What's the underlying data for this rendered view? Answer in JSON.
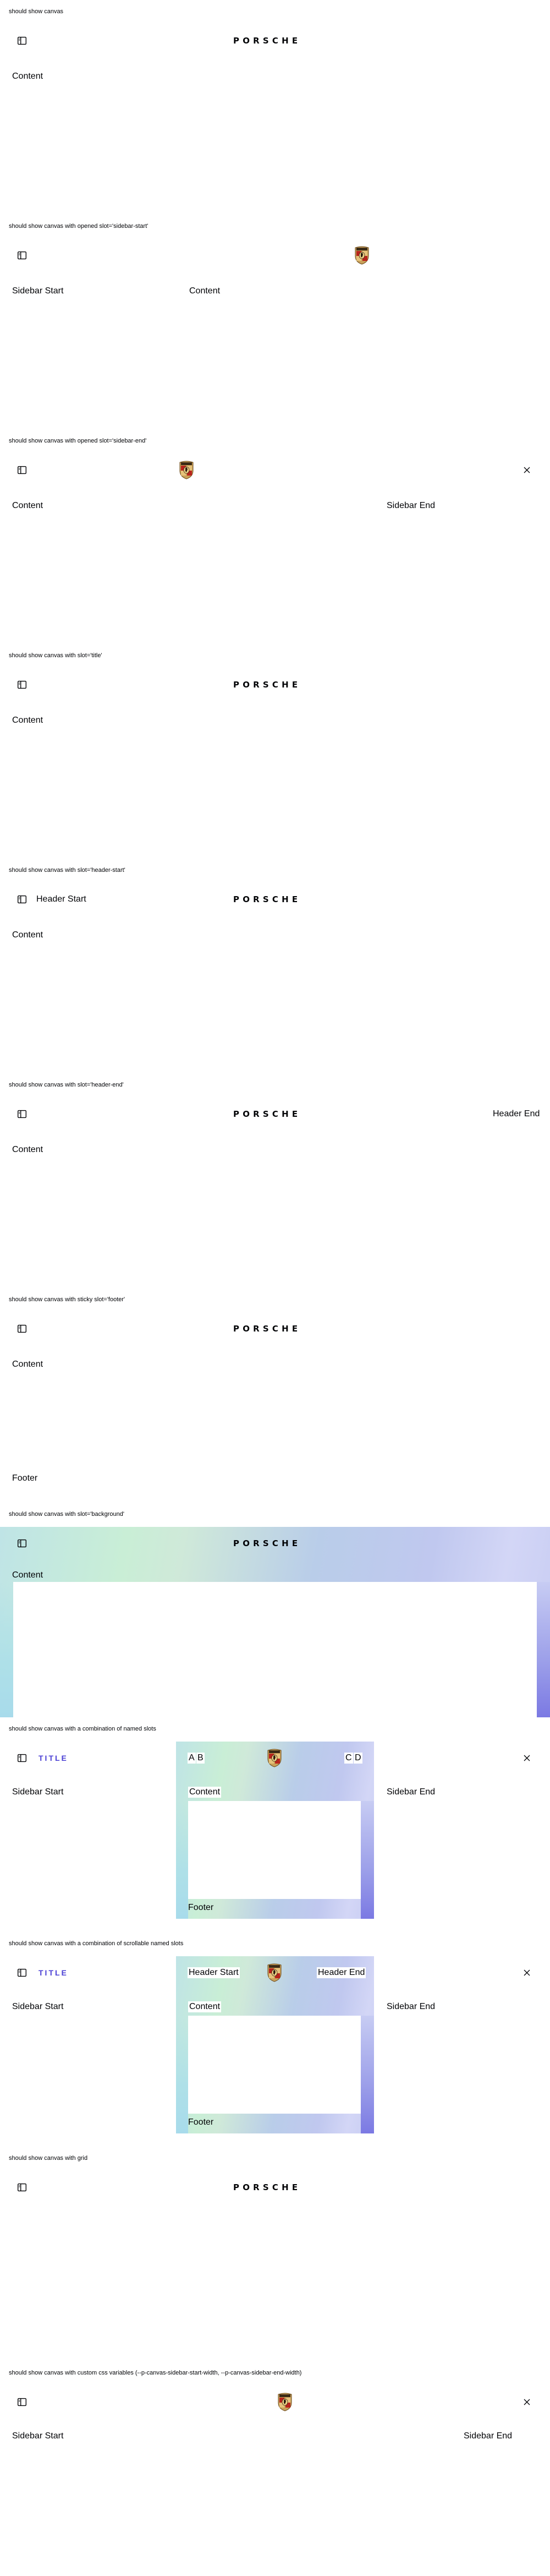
{
  "brand": {
    "wordmark": "PORSCHE"
  },
  "common": {
    "content": "Content",
    "sidebar_start": "Sidebar Start",
    "sidebar_end": "Sidebar End",
    "footer": "Footer",
    "header_start": "Header Start",
    "header_end": "Header End",
    "title": "TITLE",
    "a": "A",
    "b": "B",
    "c": "C",
    "d": "D"
  },
  "demos": [
    {
      "title": "should show canvas"
    },
    {
      "title": "should show canvas with opened slot='sidebar-start'"
    },
    {
      "title": "should show canvas with opened slot='sidebar-end'"
    },
    {
      "title": "should show canvas with slot='title'"
    },
    {
      "title": "should show canvas with slot='header-start'"
    },
    {
      "title": "should show canvas with slot='header-end'"
    },
    {
      "title": "should show canvas with sticky slot='footer'"
    },
    {
      "title": "should show canvas with slot='background'"
    },
    {
      "title": "should show canvas with a combination of named slots"
    },
    {
      "title": "should show canvas with a combination of scrollable named slots"
    },
    {
      "title": "should show canvas with grid"
    },
    {
      "title": "should show canvas with custom css variables (--p-canvas-sidebar-start-width, --p-canvas-sidebar-end-width)"
    }
  ],
  "icons": {
    "sidebar_toggle": "sidebar-toggle-icon",
    "close": "close-icon",
    "crest": "porsche-crest-icon"
  },
  "colors": {
    "text": "#010205",
    "accent": "#4a3fd4"
  }
}
